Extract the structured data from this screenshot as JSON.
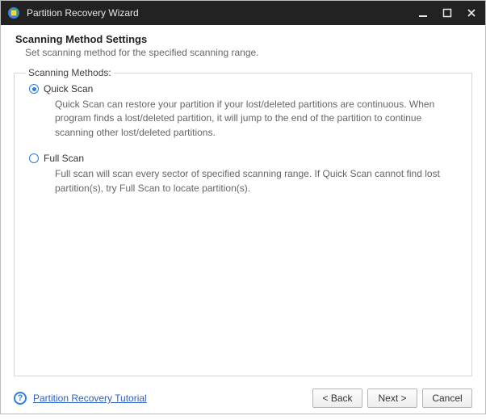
{
  "window": {
    "title": "Partition Recovery Wizard"
  },
  "header": {
    "title": "Scanning Method Settings",
    "subtitle": "Set scanning method for the specified scanning range."
  },
  "group": {
    "label": "Scanning Methods:"
  },
  "options": {
    "quick": {
      "title": "Quick Scan",
      "desc": "Quick Scan can restore your partition if your lost/deleted partitions are continuous. When program finds a lost/deleted partition, it will jump to the end of the partition to continue scanning other lost/deleted partitions.",
      "selected": true
    },
    "full": {
      "title": "Full Scan",
      "desc": "Full scan will scan every sector of specified scanning range. If Quick Scan cannot find lost partition(s), try Full Scan to locate partition(s).",
      "selected": false
    }
  },
  "footer": {
    "help_link": "Partition Recovery Tutorial",
    "buttons": {
      "back": "< Back",
      "next": "Next >",
      "cancel": "Cancel"
    }
  }
}
